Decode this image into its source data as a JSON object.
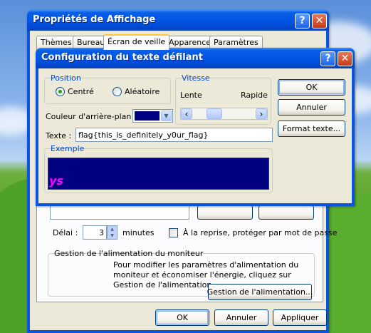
{
  "colors": {
    "title_blue": "#0055e5",
    "preview_bg": "#000080",
    "preview_text": "#ff00ff",
    "group_label": "#0046d5"
  },
  "main_window": {
    "title": "Propriétés de Affichage",
    "help_glyph": "?",
    "close_glyph": "✕",
    "tabs": [
      "Thèmes",
      "Bureau",
      "Écran de veille",
      "Apparence",
      "Paramètres"
    ],
    "active_tab": "Écran de veille",
    "delay_label": "Délai :",
    "delay_value": "3",
    "delay_unit": "minutes",
    "password_checkbox_label": "À la reprise, protéger par mot de passe",
    "password_checked": false,
    "power_group": {
      "label": "Gestion de l'alimentation du moniteur",
      "description": "Pour modifier les paramètres d'alimentation du moniteur et économiser l'énergie, cliquez sur Gestion de l'alimentation.",
      "button": "Gestion de l'alimentation..."
    },
    "buttons": {
      "ok": "OK",
      "cancel": "Annuler",
      "apply": "Appliquer"
    }
  },
  "dialog": {
    "title": "Configuration du texte défilant",
    "help_glyph": "?",
    "close_glyph": "✕",
    "position": {
      "label": "Position",
      "options": [
        "Centré",
        "Aléatoire"
      ],
      "selected": "Centré"
    },
    "speed": {
      "label": "Vitesse",
      "slow": "Lente",
      "fast": "Rapide",
      "left_arrow": "‹",
      "right_arrow": "›"
    },
    "bg_color_label": "Couleur d'arrière-plan :",
    "text_label": "Texte :",
    "text_value": "flag{this_is_definitely_y0ur_flag}",
    "example_label": "Exemple",
    "preview_text": "ys",
    "buttons": {
      "ok": "OK",
      "cancel": "Annuler",
      "format": "Format texte..."
    }
  }
}
